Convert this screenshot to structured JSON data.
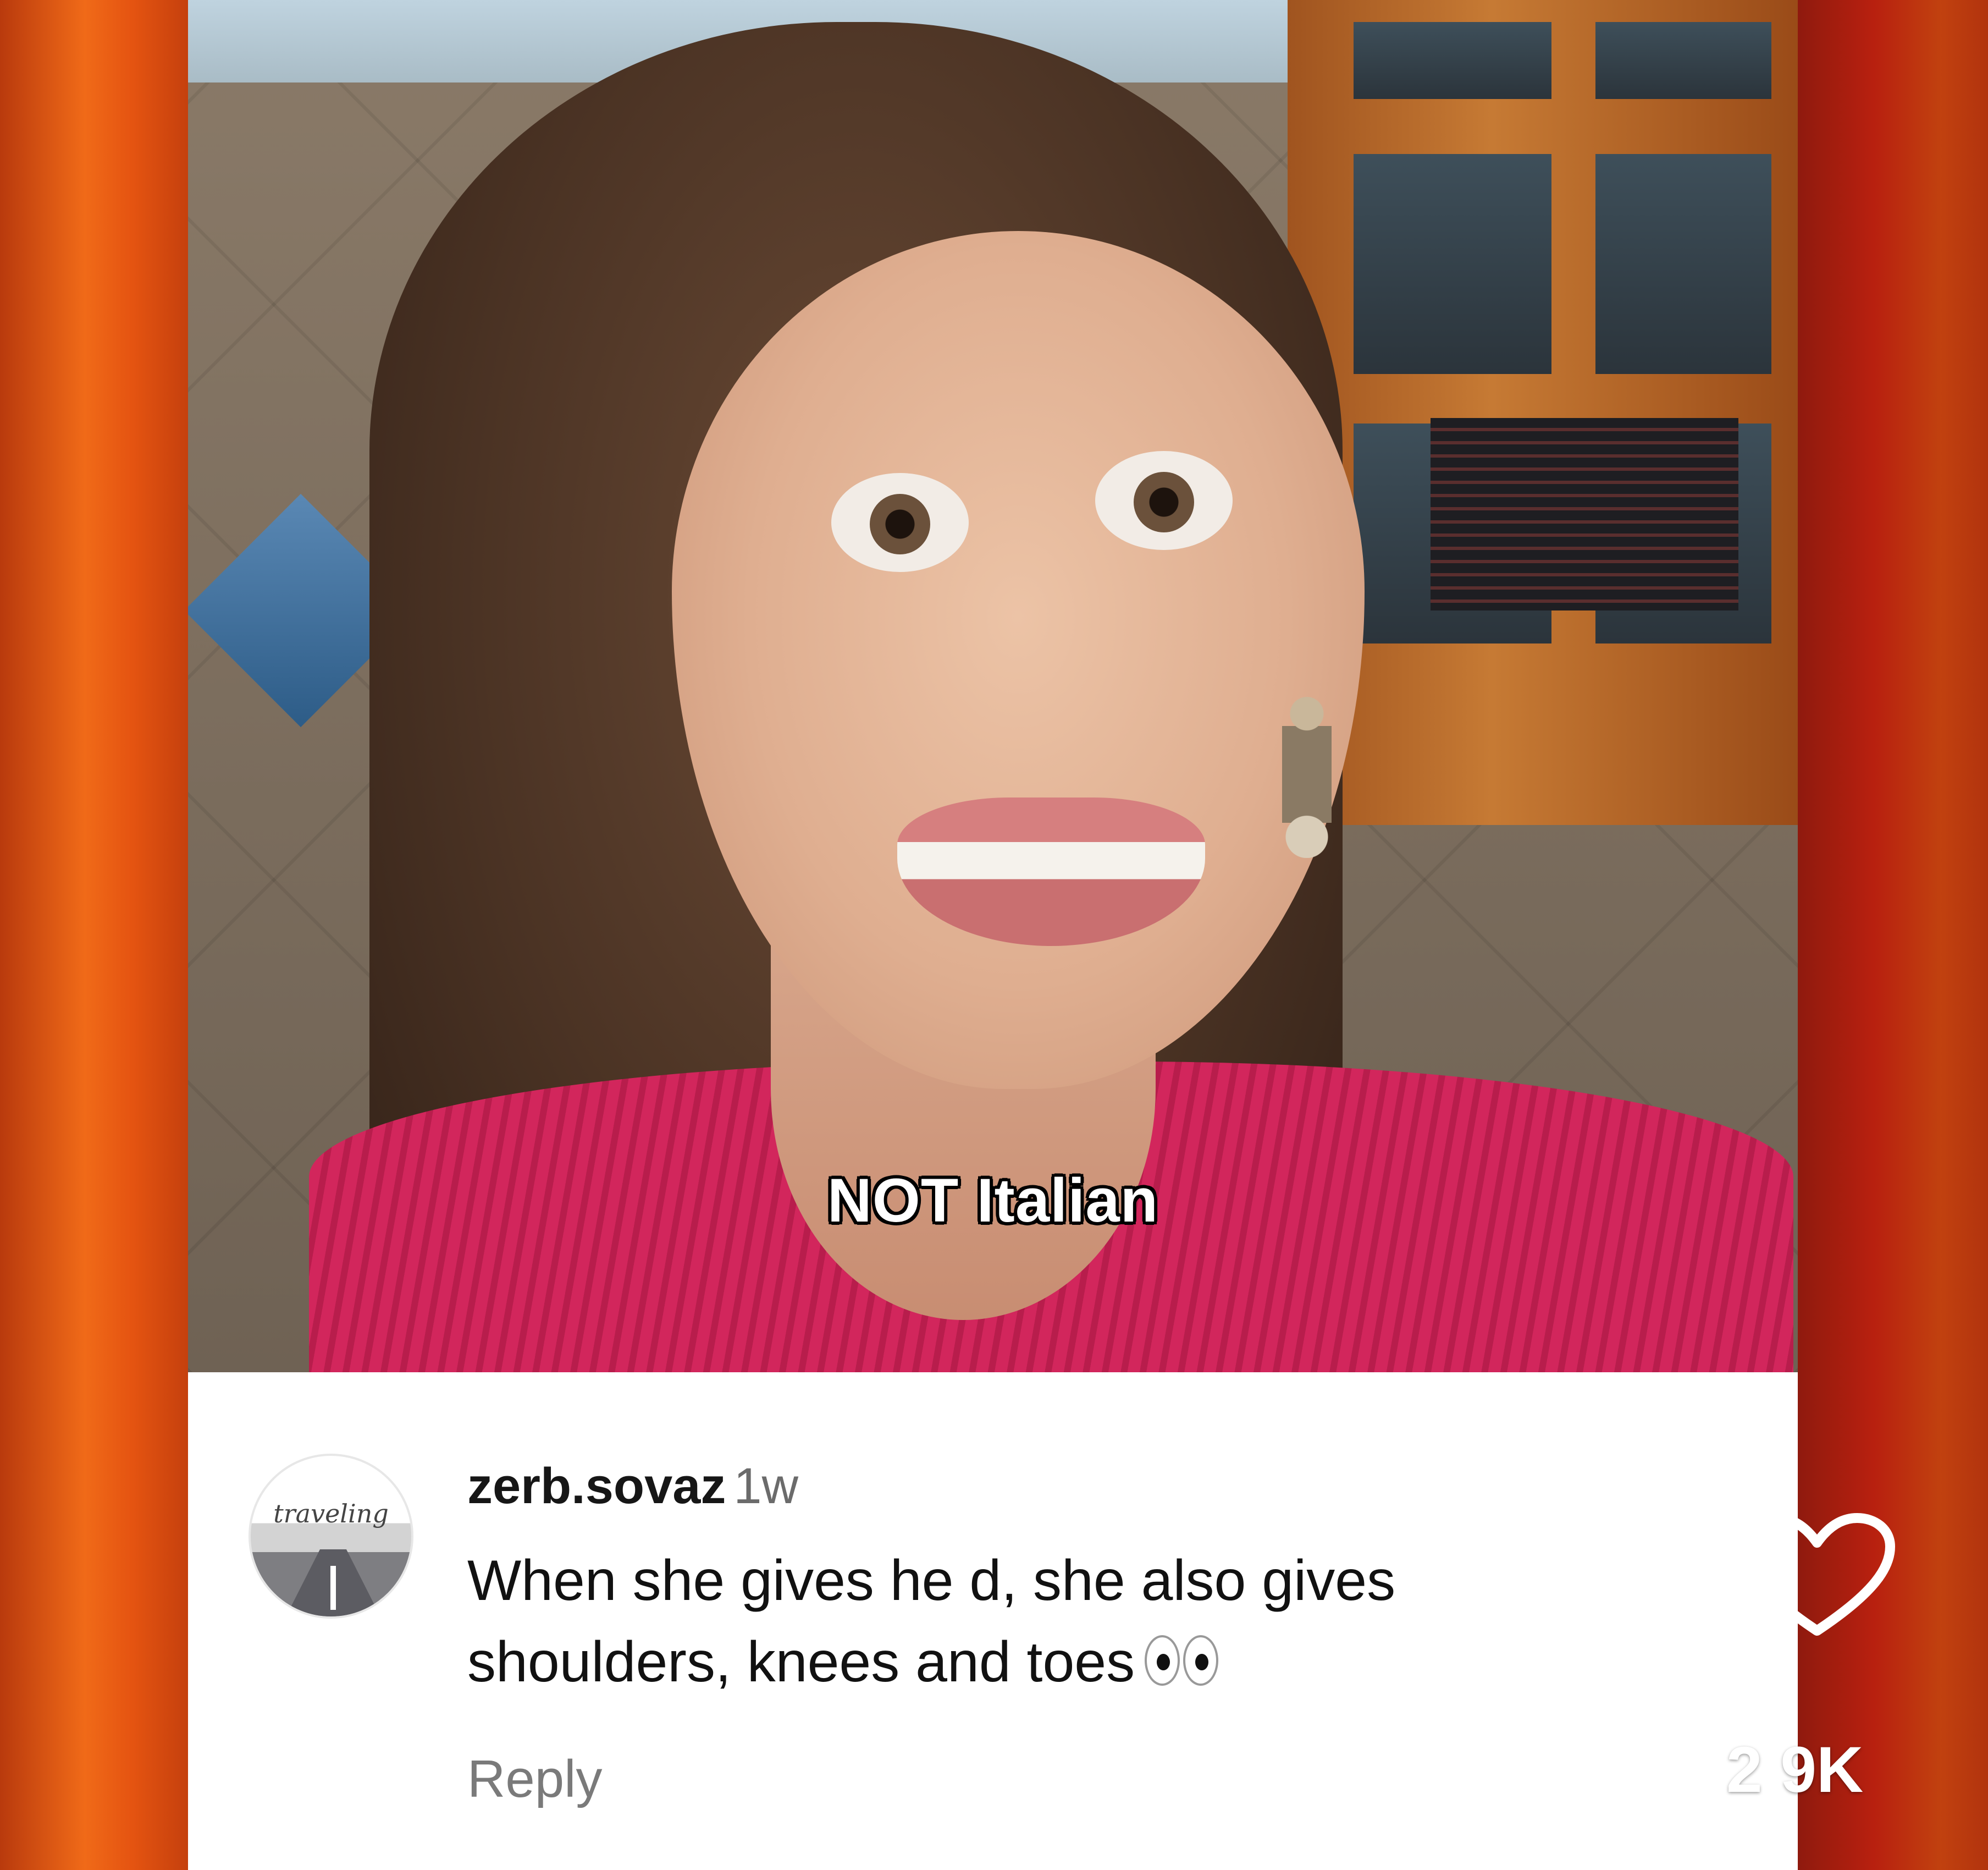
{
  "video": {
    "caption": "NOT Italian"
  },
  "comment": {
    "username": "zerb.sovaz",
    "timestamp": "1w",
    "text_line1": "When she gives he d, she also gives",
    "text_line2": "shoulders, knees and toes",
    "emoji": "eyes-emoji",
    "reply_label": "Reply",
    "avatar_text": "traveling"
  },
  "like": {
    "icon": "heart-outline-icon",
    "count": "2 9K"
  },
  "colors": {
    "left_border": "#f06a18",
    "right_border": "#b8200f",
    "card_bg": "#ffffff",
    "shirt": "#d2265c"
  }
}
